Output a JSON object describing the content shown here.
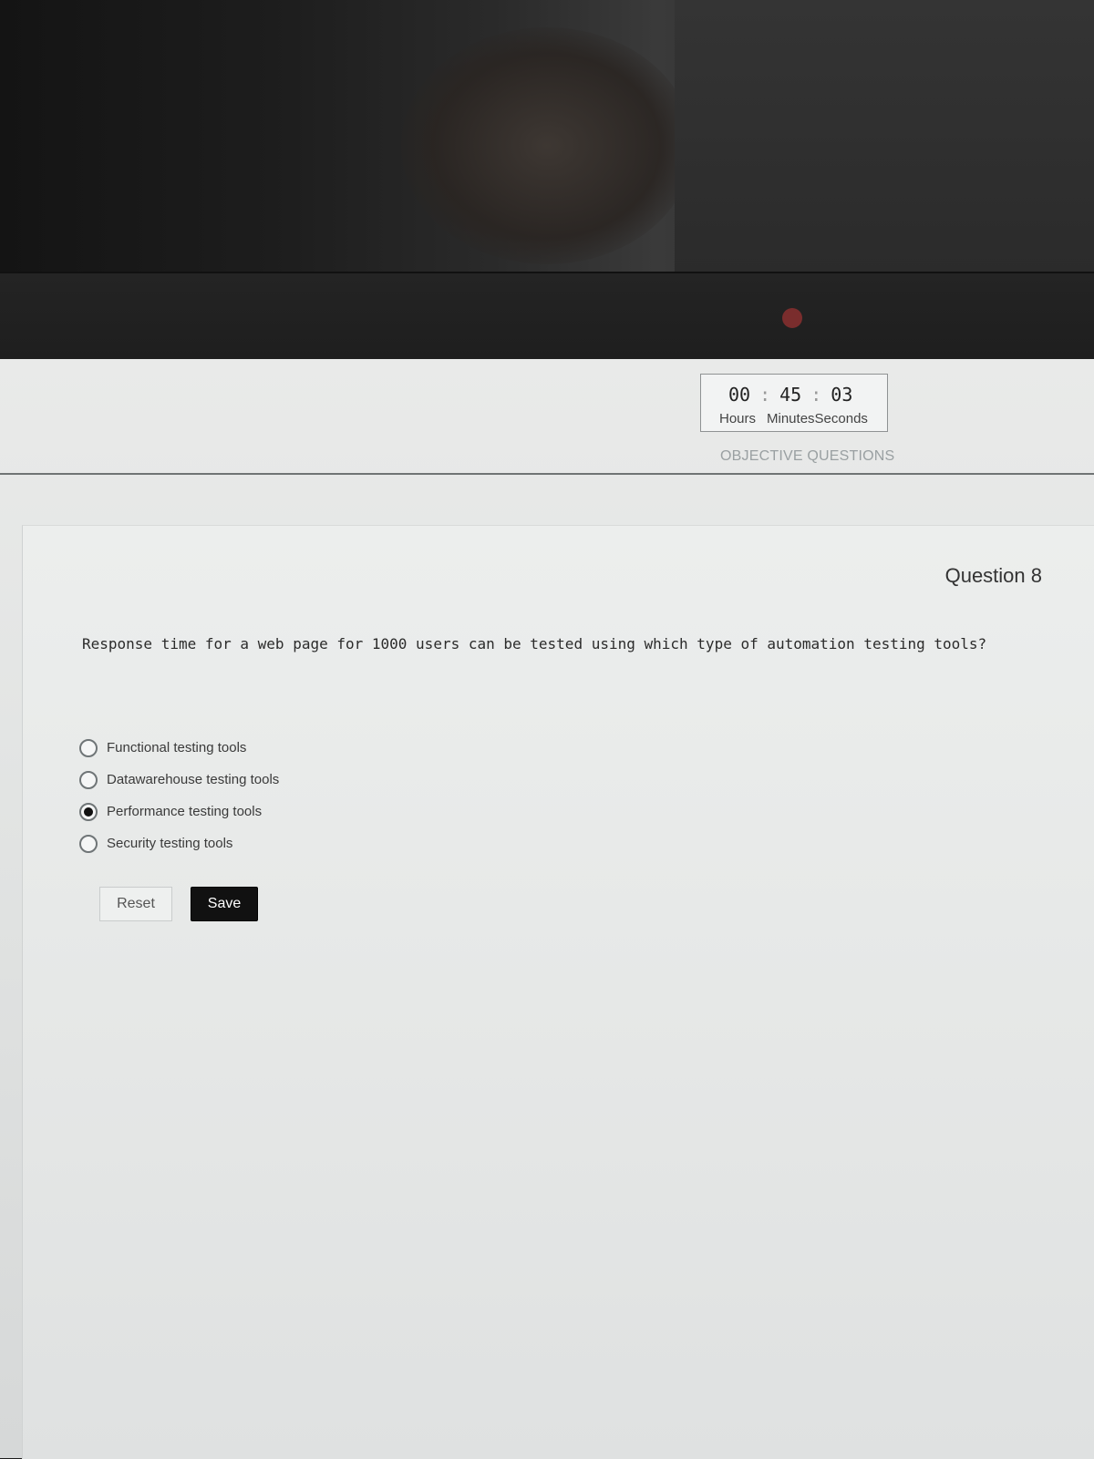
{
  "timer": {
    "hours": "00",
    "minutes": "45",
    "seconds": "03",
    "hours_label": "Hours",
    "minutes_label": "Minutes",
    "seconds_label": "Seconds"
  },
  "section": {
    "title": "OBJECTIVE QUESTIONS"
  },
  "question": {
    "number_label": "Question 8",
    "text": "Response time for a web page for 1000 users can be tested using which type of automation testing tools?",
    "options": [
      {
        "label": "Functional testing tools",
        "selected": false
      },
      {
        "label": "Datawarehouse testing tools",
        "selected": false
      },
      {
        "label": "Performance testing tools",
        "selected": true
      },
      {
        "label": "Security testing tools",
        "selected": false
      }
    ]
  },
  "actions": {
    "reset_label": "Reset",
    "save_label": "Save"
  }
}
